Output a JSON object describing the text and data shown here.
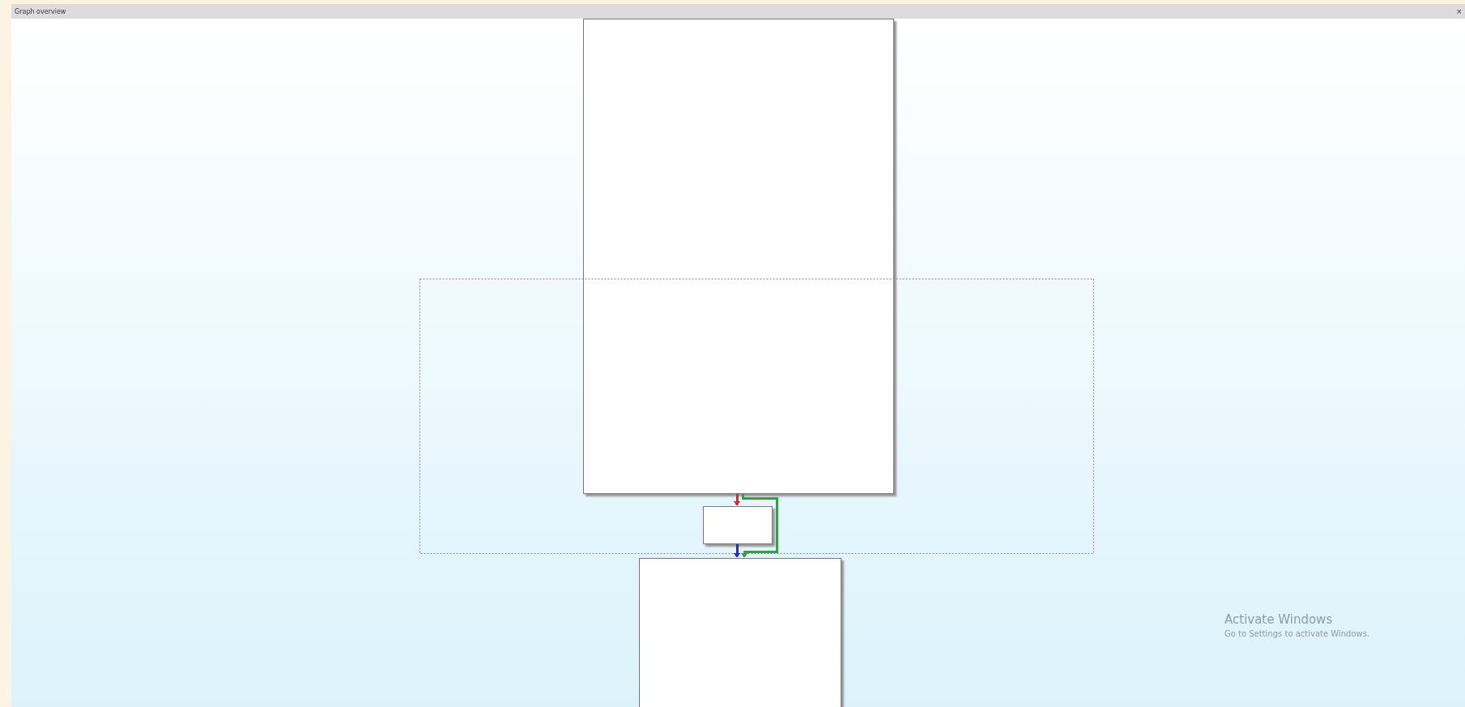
{
  "window": {
    "title": "Graph overview",
    "close": "×"
  },
  "graph": {
    "edges": [
      {
        "color": "#e02828"
      },
      {
        "color": "#3c9a50"
      },
      {
        "color": "#2828d0"
      }
    ]
  },
  "activation_notice": {
    "title": "Activate Windows",
    "message": "Go to Settings to activate Windows."
  }
}
